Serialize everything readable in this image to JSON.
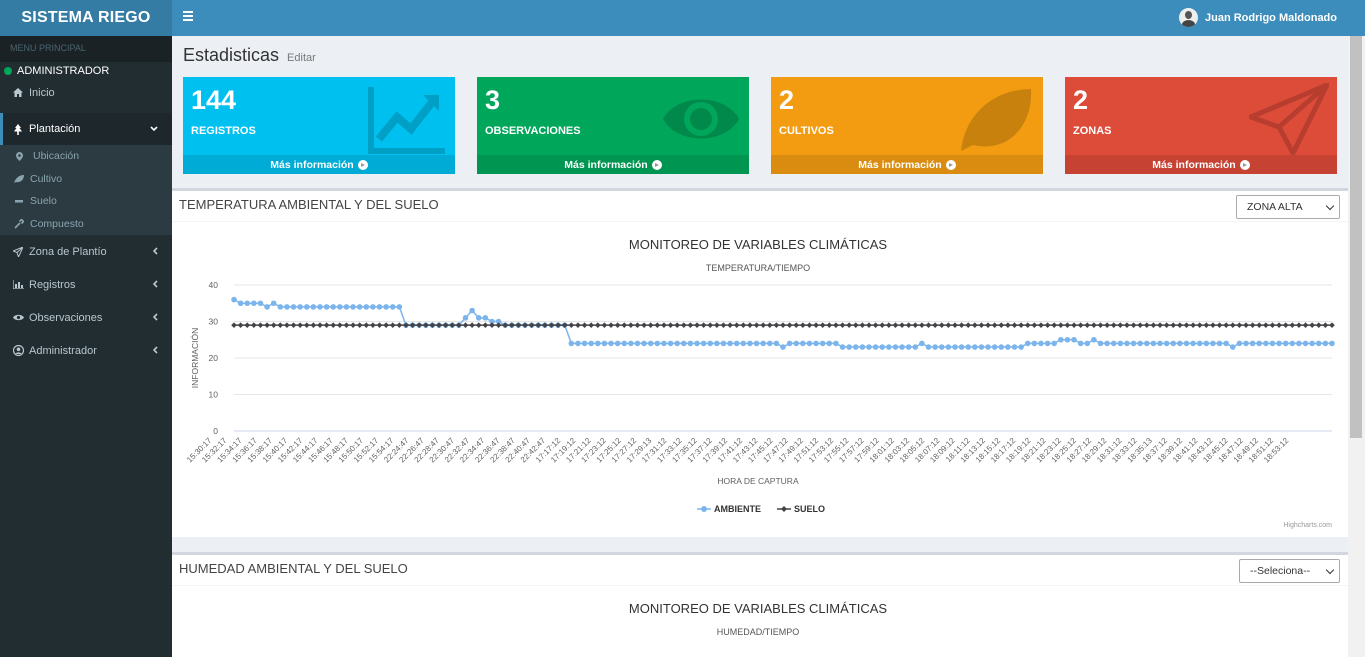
{
  "app": {
    "logo": "SISTEMA RIEGO",
    "user_name": "Juan Rodrigo Maldonado"
  },
  "sidebar": {
    "header": "MENU PRINCIPAL",
    "status": "ADMINISTRADOR",
    "items": [
      {
        "label": "Inicio",
        "icon": "home-icon"
      },
      {
        "label": "Plantación",
        "icon": "tree-icon",
        "active": true
      },
      {
        "label": "Zona de Plantío",
        "icon": "paper-plane-icon"
      },
      {
        "label": "Registros",
        "icon": "bar-chart-icon"
      },
      {
        "label": "Observaciones",
        "icon": "eye-icon"
      },
      {
        "label": "Administrador",
        "icon": "user-circle-icon"
      }
    ],
    "subitems": [
      {
        "label": "Ubicación",
        "icon": "map-marker-icon"
      },
      {
        "label": "Cultivo",
        "icon": "leaf-icon"
      },
      {
        "label": "Suelo",
        "icon": "minus-icon"
      },
      {
        "label": "Compuesto",
        "icon": "eyedropper-icon"
      }
    ]
  },
  "page": {
    "title": "Estadisticas",
    "subtitle": "Editar"
  },
  "stats": [
    {
      "value": "144",
      "label": "REGISTROS",
      "footer": "Más información",
      "color": "#00c0ef",
      "icon": "line-chart-icon"
    },
    {
      "value": "3",
      "label": "OBSERVACIONES",
      "footer": "Más información",
      "color": "#00a65a",
      "icon": "eye-icon"
    },
    {
      "value": "2",
      "label": "CULTIVOS",
      "footer": "Más información",
      "color": "#f39c12",
      "icon": "leaf-icon"
    },
    {
      "value": "2",
      "label": "ZONAS",
      "footer": "Más información",
      "color": "#dd4b39",
      "icon": "paper-plane-icon"
    }
  ],
  "panels": [
    {
      "title": "TEMPERATURA AMBIENTAL Y DEL SUELO",
      "select_value": "ZONA ALTA"
    },
    {
      "title": "HUMEDAD AMBIENTAL Y DEL SUELO",
      "select_value": "--Seleciona--"
    }
  ],
  "chart_data": [
    {
      "type": "line",
      "title": "MONITOREO DE VARIABLES CLIMÁTICAS",
      "subtitle": "TEMPERATURA/TIEMPO",
      "xlabel": "HORA DE CAPTURA",
      "ylabel": "INFORMACIÓN",
      "ylim": [
        0,
        40
      ],
      "yticks": [
        0,
        10,
        20,
        30,
        40
      ],
      "credit": "Highcharts.com",
      "legend": "bottom-center",
      "grid": true,
      "x": [
        "15:30:17",
        "15:32:17",
        "15:34:17",
        "15:36:17",
        "15:38:17",
        "15:40:17",
        "15:42:17",
        "15:44:17",
        "15:46:17",
        "15:48:17",
        "15:50:17",
        "15:52:17",
        "15:54:17",
        "22:24:47",
        "22:26:47",
        "22:28:47",
        "22:30:47",
        "22:32:47",
        "22:34:47",
        "22:36:47",
        "22:38:47",
        "22:40:47",
        "22:42:47",
        "17:17:12",
        "17:19:12",
        "17:21:12",
        "17:23:12",
        "17:25:12",
        "17:27:12",
        "17:29:13",
        "17:31:12",
        "17:33:12",
        "17:35:12",
        "17:37:12",
        "17:39:12",
        "17:41:12",
        "17:43:12",
        "17:45:12",
        "17:47:12",
        "17:49:12",
        "17:51:12",
        "17:53:12",
        "17:55:12",
        "17:57:12",
        "17:59:12",
        "18:01:12",
        "18:03:12",
        "18:05:12",
        "18:07:12",
        "18:09:12",
        "18:11:12",
        "18:13:12",
        "18:15:12",
        "18:17:12",
        "18:19:12",
        "18:21:12",
        "18:23:12",
        "18:25:12",
        "18:27:12",
        "18:29:12",
        "18:31:12",
        "18:33:12",
        "18:35:13",
        "18:37:12",
        "18:39:12",
        "18:41:12",
        "18:43:12",
        "18:45:12",
        "18:47:12",
        "18:49:12",
        "18:51:12",
        "18:53:12"
      ],
      "series": [
        {
          "name": "AMBIENTE",
          "color": "#7cb5ec",
          "marker": "circle",
          "values": [
            36,
            35,
            35,
            35,
            35,
            34,
            35,
            34,
            34,
            34,
            34,
            34,
            34,
            34,
            34,
            34,
            34,
            34,
            34,
            34,
            34,
            34,
            34,
            34,
            34,
            34,
            29,
            29,
            29,
            29,
            29,
            29,
            29,
            29,
            29,
            31,
            33,
            31,
            31,
            30,
            30,
            29,
            29,
            29,
            29,
            29,
            29,
            29,
            29,
            29,
            29,
            24,
            24,
            24,
            24,
            24,
            24,
            24,
            24,
            24,
            24,
            24,
            24,
            24,
            24,
            24,
            24,
            24,
            24,
            24,
            24,
            24,
            24,
            24,
            24,
            24,
            24,
            24,
            24,
            24,
            24,
            24,
            24,
            23,
            24,
            24,
            24,
            24,
            24,
            24,
            24,
            24,
            23,
            23,
            23,
            23,
            23,
            23,
            23,
            23,
            23,
            23,
            23,
            23,
            24,
            23,
            23,
            23,
            23,
            23,
            23,
            23,
            23,
            23,
            23,
            23,
            23,
            23,
            23,
            23,
            24,
            24,
            24,
            24,
            24,
            25,
            25,
            25,
            24,
            24,
            25,
            24,
            24,
            24,
            24,
            24,
            24,
            24,
            24,
            24,
            24,
            24,
            24,
            24,
            24,
            24,
            24,
            24,
            24,
            24,
            24,
            23,
            24,
            24,
            24,
            24,
            24,
            24,
            24,
            24,
            24,
            24,
            24,
            24,
            24,
            24,
            24
          ]
        },
        {
          "name": "SUELO",
          "color": "#434348",
          "marker": "diamond",
          "values": [
            29,
            29,
            29,
            29,
            29,
            29,
            29,
            29,
            29,
            29,
            29,
            29,
            29,
            29,
            29,
            29,
            29,
            29,
            29,
            29,
            29,
            29,
            29,
            29,
            29,
            29,
            29,
            29,
            29,
            29,
            29,
            29,
            29,
            29,
            29,
            29,
            29,
            29,
            29,
            29,
            29,
            29,
            29,
            29,
            29,
            29,
            29,
            29,
            29,
            29,
            29,
            29,
            29,
            29,
            29,
            29,
            29,
            29,
            29,
            29,
            29,
            29,
            29,
            29,
            29,
            29,
            29,
            29,
            29,
            29,
            29,
            29,
            29,
            29,
            29,
            29,
            29,
            29,
            29,
            29,
            29,
            29,
            29,
            29,
            29,
            29,
            29,
            29,
            29,
            29,
            29,
            29,
            29,
            29,
            29,
            29,
            29,
            29,
            29,
            29,
            29,
            29,
            29,
            29,
            29,
            29,
            29,
            29,
            29,
            29,
            29,
            29,
            29,
            29,
            29,
            29,
            29,
            29,
            29,
            29,
            29,
            29,
            29,
            29,
            29,
            29,
            29,
            29,
            29,
            29,
            29,
            29,
            29,
            29,
            29,
            29,
            29,
            29,
            29,
            29,
            29,
            29,
            29,
            29,
            29,
            29,
            29,
            29,
            29,
            29,
            29,
            29,
            29,
            29,
            29,
            29,
            29,
            29,
            29,
            29,
            29,
            29,
            29,
            29,
            29,
            29,
            29
          ]
        }
      ]
    },
    {
      "type": "line",
      "title": "MONITOREO DE VARIABLES CLIMÁTICAS",
      "subtitle": "HUMEDAD/TIEMPO"
    }
  ]
}
